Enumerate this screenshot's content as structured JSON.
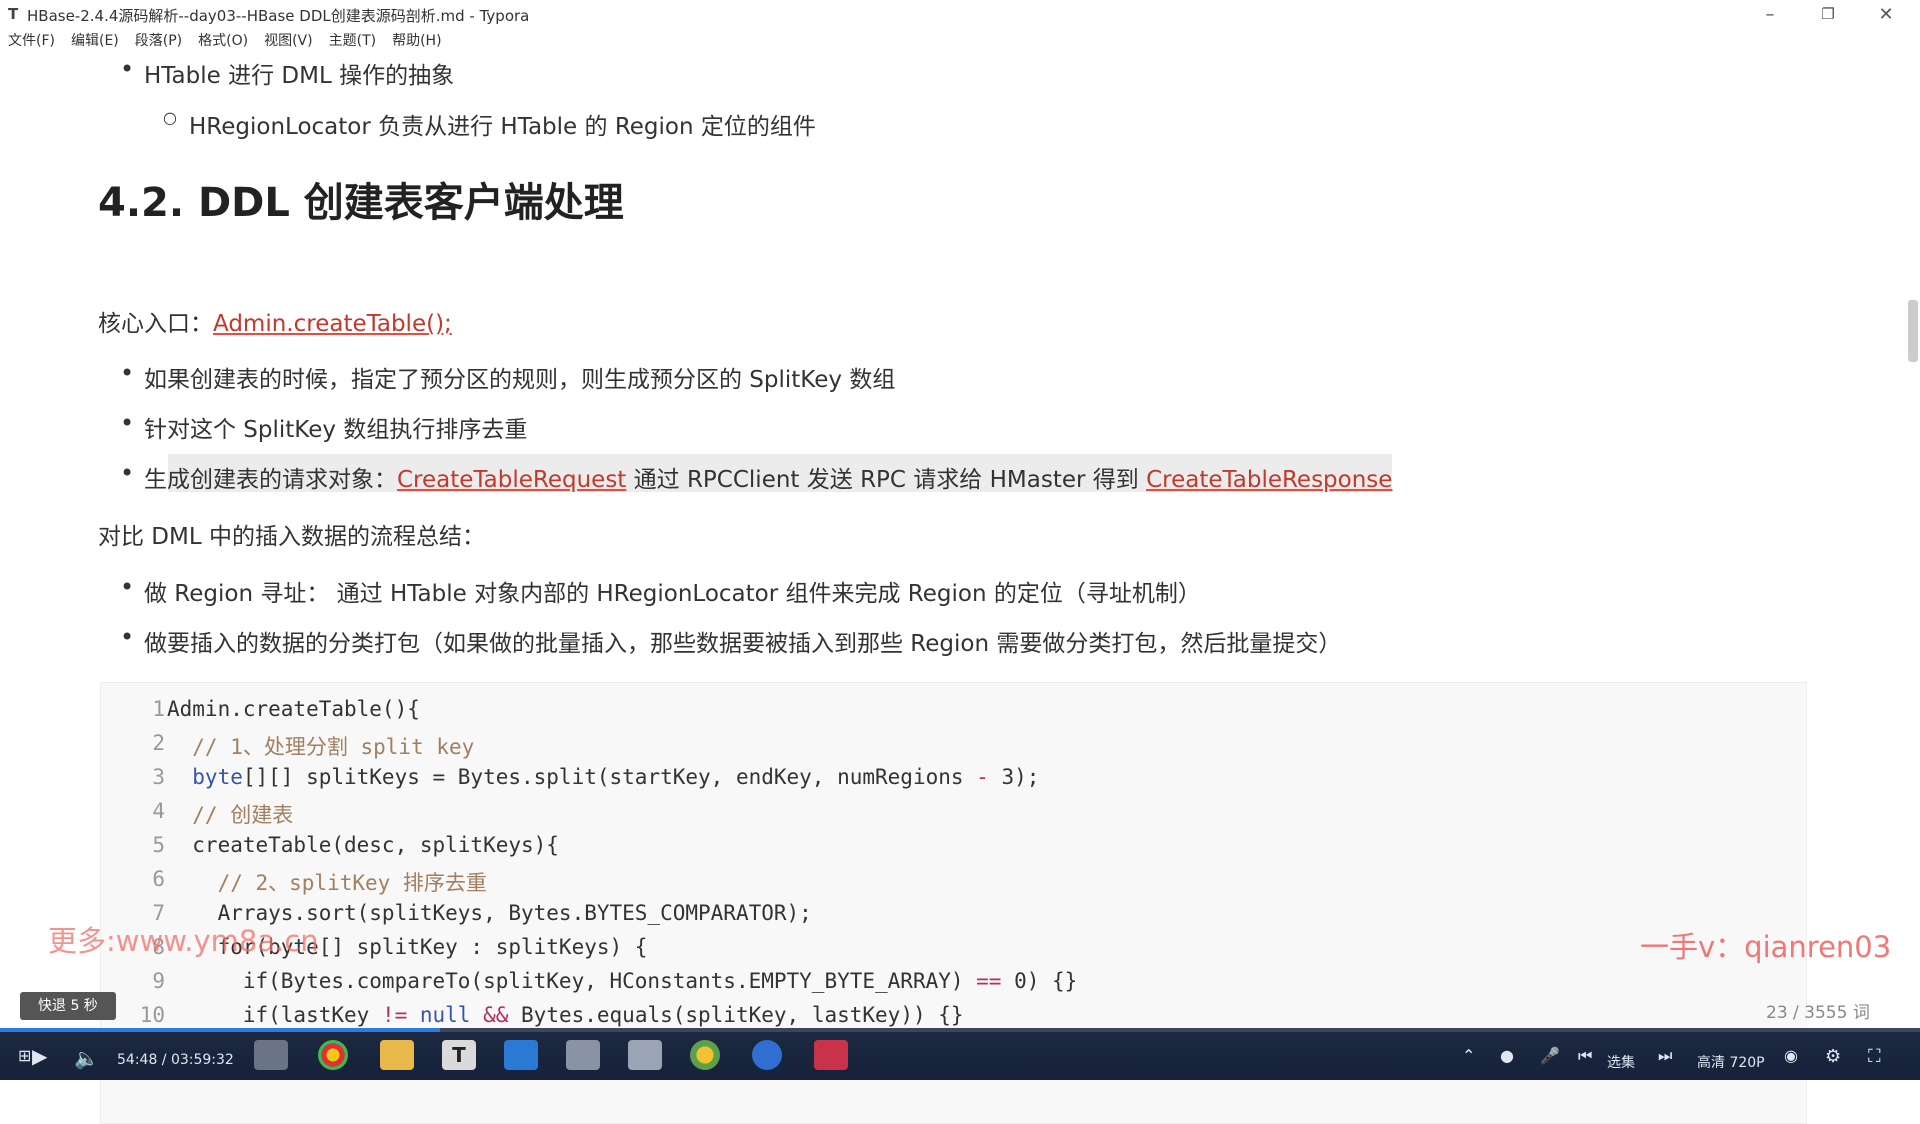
{
  "window": {
    "app_icon_text": "T",
    "title": "HBase-2.4.4源码解析--day03--HBase DDL创建表源码剖析.md - Typora",
    "minimize": "–",
    "restore": "❐",
    "close": "✕"
  },
  "menu": [
    "文件(F)",
    "编辑(E)",
    "段落(P)",
    "格式(O)",
    "视图(V)",
    "主题(T)",
    "帮助(H)"
  ],
  "doc": {
    "bullet_htable": "HTable 进行 DML 操作的抽象",
    "sub_locator": "HRegionLocator 负责从进行 HTable 的 Region 定位的组件",
    "heading": "4.2. DDL 创建表客户端处理",
    "entry_label": "核心入口：",
    "entry_link": "Admin.createTable();",
    "list1": [
      "如果创建表的时候，指定了预分区的规则，则生成预分区的 SplitKey 数组",
      "针对这个 SplitKey 数组执行排序去重"
    ],
    "list1_3_a": "生成创建表的请求对象：",
    "list1_3_link1": "CreateTableRequest",
    "list1_3_b": " 通过 RPCClient 发送 RPC 请求给 HMaster 得到 ",
    "list1_3_link2": "CreateTableResponse",
    "compare_para": "对比 DML 中的插入数据的流程总结：",
    "list2": [
      "做 Region 寻址：  通过 HTable 对象内部的 HRegionLocator 组件来完成 Region 的定位（寻址机制）",
      "做要插入的数据的分类打包（如果做的批量插入，那些数据要被插入到那些 Region 需要做分类打包，然后批量提交）"
    ]
  },
  "code": {
    "line_numbers": [
      "1",
      "2",
      "3",
      "4",
      "5",
      "6",
      "7",
      "8",
      "9",
      "10"
    ],
    "l1": "Admin.createTable(){",
    "l2": "  // 1、处理分割 split key",
    "l3_kw": "  byte",
    "l3_a": "[][] splitKeys = Bytes.split(startKey, endKey, numRegions ",
    "l3_op": "-",
    "l3_b": " 3);",
    "l4": "  // 创建表",
    "l5": "  createTable(desc, splitKeys){",
    "l6": "    // 2、splitKey 排序去重",
    "l7": "    Arrays.sort(splitKeys, Bytes.BYTES_COMPARATOR);",
    "l8": "    for(byte[] splitKey : splitKeys) {",
    "l9_a": "      if(Bytes.compareTo(splitKey, HConstants.EMPTY_BYTE_ARRAY) ",
    "l9_op": "==",
    "l9_b": " 0) {}",
    "l10_a": "      if(lastKey ",
    "l10_op1": "!=",
    "l10_kw": " null",
    "l10_op2": " &&",
    "l10_b": " Bytes.equals(splitKey, lastKey)) {}"
  },
  "overlay": {
    "watermark_left": "更多:www.ym8a.cn",
    "watermark_right": "一手v：qianren03",
    "word_count": "23 / 3555 词",
    "seek_hint": "快退 5 秒"
  },
  "player": {
    "time": "54:48 / 03:59:32",
    "progress": 0.229,
    "episodes": "选集",
    "quality": "高清 720P"
  },
  "colors": {
    "accent": "#2d7be0",
    "link": "#c0392b",
    "player_bg": "#16213a"
  }
}
